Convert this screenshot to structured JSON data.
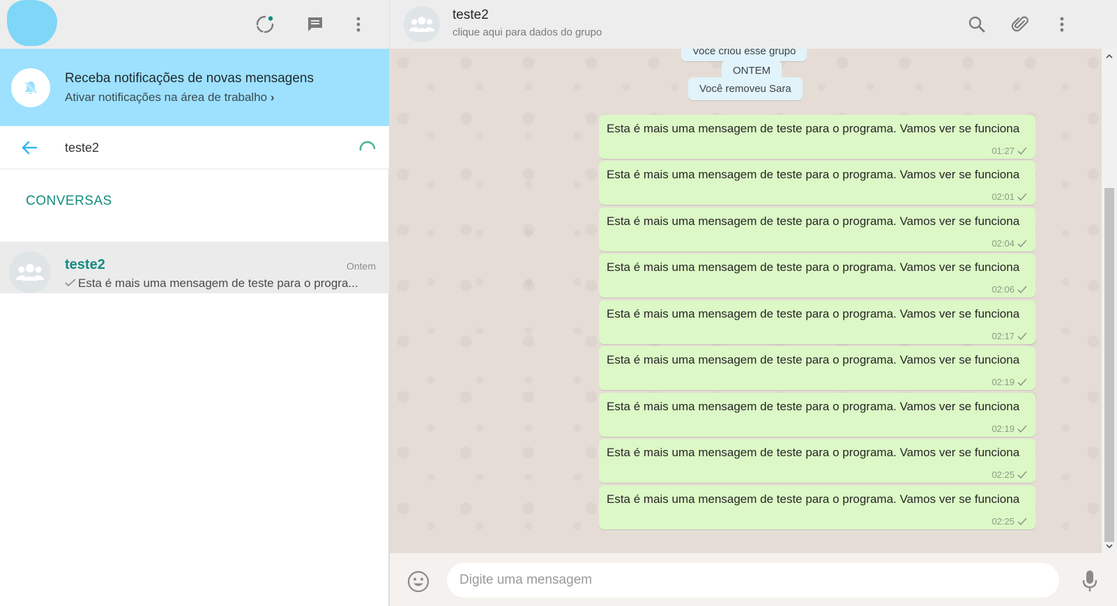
{
  "sidebar": {
    "notification": {
      "title": "Receba notificações de novas mensagens",
      "subtitle": "Ativar notificações na área de trabalho"
    },
    "search": {
      "value": "teste2"
    },
    "section_title": "CONVERSAS",
    "chats": [
      {
        "name": "teste2",
        "time": "Ontem",
        "preview": "Esta é mais uma mensagem de teste para o progra..."
      }
    ]
  },
  "conversation": {
    "name": "teste2",
    "subtitle": "clique aqui para dados do grupo",
    "system_messages": [
      "Você criou esse grupo",
      "ONTEM",
      "Você removeu Sara"
    ],
    "messages": [
      {
        "text": "Esta é mais uma mensagem de teste para o programa. Vamos ver se funciona",
        "time": "01:27"
      },
      {
        "text": "Esta é mais uma mensagem de teste para o programa. Vamos ver se funciona",
        "time": "02:01"
      },
      {
        "text": "Esta é mais uma mensagem de teste para o programa. Vamos ver se funciona",
        "time": "02:04"
      },
      {
        "text": "Esta é mais uma mensagem de teste para o programa. Vamos ver se funciona",
        "time": "02:06"
      },
      {
        "text": "Esta é mais uma mensagem de teste para o programa. Vamos ver se funciona",
        "time": "02:17"
      },
      {
        "text": "Esta é mais uma mensagem de teste para o programa. Vamos ver se funciona",
        "time": "02:19"
      },
      {
        "text": "Esta é mais uma mensagem de teste para o programa. Vamos ver se funciona",
        "time": "02:19"
      },
      {
        "text": "Esta é mais uma mensagem de teste para o programa. Vamos ver se funciona",
        "time": "02:25"
      },
      {
        "text": "Esta é mais uma mensagem de teste para o programa. Vamos ver se funciona",
        "time": "02:25"
      }
    ]
  },
  "composer": {
    "placeholder": "Digite uma mensagem"
  },
  "colors": {
    "accent": "#128c7e",
    "notification_bg": "#9de1fe",
    "outgoing_bubble": "#dcf8c6",
    "system_bubble": "#e1f3fb",
    "chat_bg": "#e5ddd5",
    "back_arrow": "#33b7f6",
    "spinner": "#4fb39b"
  },
  "icons": [
    "status-icon",
    "new-chat-icon",
    "menu-icon",
    "notifications-off-icon",
    "back-arrow-icon",
    "loading-spinner-icon",
    "group-icon",
    "search-icon",
    "attach-icon",
    "emoji-icon",
    "microphone-icon",
    "checkmark-icon"
  ]
}
